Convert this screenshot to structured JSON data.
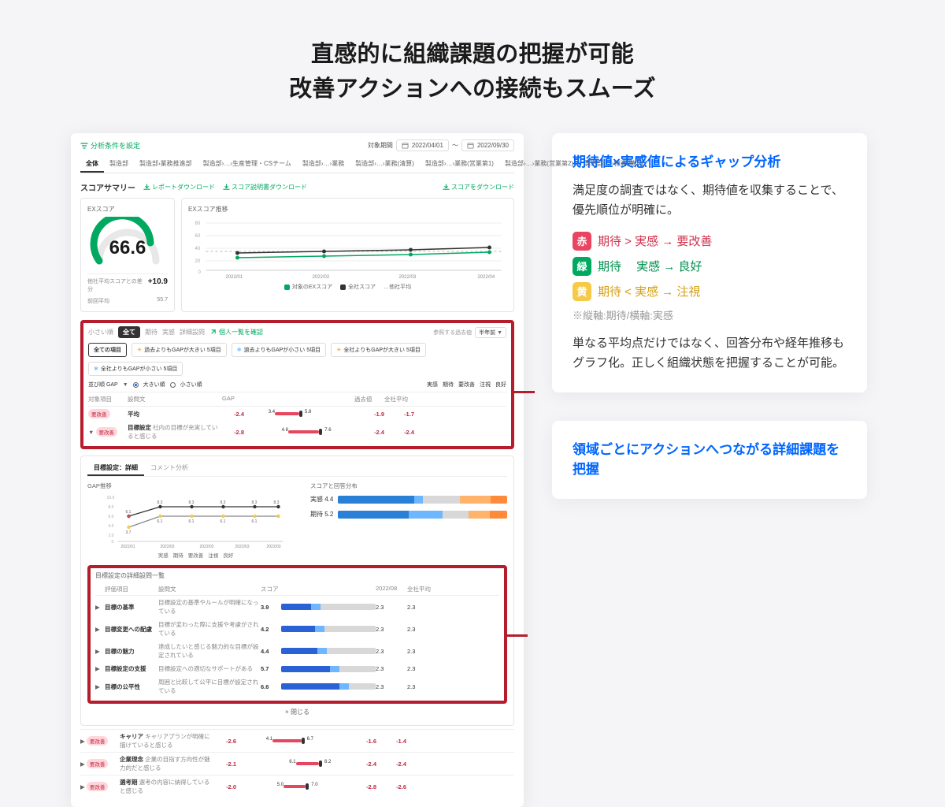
{
  "page_title_1": "直感的に組織課題の把握が可能",
  "page_title_2": "改善アクションへの接続もスムーズ",
  "app": {
    "filter_link": "分析条件を設定",
    "date_label": "対象期間",
    "date_from": "2022/04/01",
    "date_to": "2022/09/30",
    "tabs": [
      "全体",
      "製造部",
      "製造部›業務推進部",
      "製造部›…›生産管理・CSチーム",
      "製造部›…›業務",
      "製造部›…›業務(清算)",
      "製造部›…›業務(営業第1)",
      "製造部›…›業務(営業第2)",
      "製造部›…›物流(横浜)"
    ],
    "summary_title": "スコアサマリー",
    "dl_report": "レポートダウンロード",
    "dl_desc": "スコア説明書ダウンロード",
    "dl_score": "スコアをダウンロード",
    "ex_title": "EXスコア",
    "ex_score": "66.6",
    "diff_label": "他社平均スコアとの差分",
    "diff_value": "+10.9",
    "diff_prev_label": "前回平均",
    "diff_prev": "55.7",
    "trend_title": "EXスコア推移",
    "trend_x": [
      "2022/01",
      "2022/02",
      "2022/03",
      "2022/04"
    ],
    "legend_target": "対象のEXスコア",
    "legend_all": "全社スコア",
    "legend_avg": "…他社平均",
    "filter": {
      "small_order": "小さい順",
      "all": "全て",
      "exp": "期待",
      "real": "実感",
      "detail": "詳細設問",
      "individual": "個人一覧を確認",
      "past_label": "参照する過去値",
      "past_val": "半年前"
    },
    "chips": {
      "all_items": "全ての項目",
      "past_large": "過去よりもGAPが大きい 5項目",
      "past_small": "過去よりもGAPが小さい 5項目",
      "all_large": "全社よりもGAPが大きい 5項目",
      "all_small": "全社よりもGAPが小さい 5項目"
    },
    "sort": {
      "label": "並び順 GAP",
      "large": "大きい順",
      "small": "小さい順",
      "real": "実感",
      "exp": "期待",
      "imp": "要改善",
      "note": "注視",
      "good": "良好"
    },
    "gap_head": {
      "c1": "対象項目",
      "c2": "設問文",
      "c3": "GAP",
      "c4": "過去値",
      "c5": "全社平均"
    },
    "gap_rows": [
      {
        "badge": "要改善",
        "label": "平均",
        "gap": "-2.4",
        "b1": "3.4",
        "b2": "5.8",
        "past": "-1.9",
        "all": "-1.7"
      },
      {
        "badge": "要改善",
        "caret": "▼",
        "label": "目標設定",
        "text": "社内の目標が充実していると感じる",
        "gap": "-2.8",
        "b1": "4.8",
        "b2": "7.6",
        "past": "-2.4",
        "all": "-2.4"
      }
    ],
    "detail": {
      "tab1": "目標設定：詳細",
      "tab2": "コメント分析",
      "gtrend": "GAP推移",
      "gtrend_x": [
        "2022/01",
        "2022/02",
        "2022/02",
        "2022/03",
        "2022/03"
      ],
      "gtrend_vals": [
        "6.1",
        "8.3",
        "8.3",
        "8.3",
        "8.3",
        "8.3"
      ],
      "gtrend_low": "3.7",
      "dist_title": "スコアと回答分布",
      "dist1_label": "実感 4.4",
      "dist2_label": "期待 5.2",
      "legend2": [
        "実感",
        "期待",
        "要改善",
        "注視",
        "良好"
      ]
    },
    "questions": {
      "head": "目標設定の詳細設問一覧",
      "h": {
        "c1": "評価項目",
        "c2": "設問文",
        "c3": "スコア",
        "c4": "2022/08",
        "c5": "全社平均"
      },
      "rows": [
        {
          "name": "目標の基準",
          "q": "目標設定の基準やルールが明確になっている",
          "score": "3.9",
          "past": "2.3",
          "all": "2.3"
        },
        {
          "name": "目標変更への配慮",
          "q": "目標が変わった際に支援や考慮がされている",
          "score": "4.2",
          "past": "2.3",
          "all": "2.3"
        },
        {
          "name": "目標の魅力",
          "q": "達成したいと感じる魅力的な目標が設定されている",
          "score": "4.4",
          "past": "2.3",
          "all": "2.3"
        },
        {
          "name": "目標設定の支援",
          "q": "目標設定への適切なサポートがある",
          "score": "5.7",
          "past": "2.3",
          "all": "2.3"
        },
        {
          "name": "目標の公平性",
          "q": "周囲と比較して公平に目標が設定されている",
          "score": "6.6",
          "past": "2.3",
          "all": "2.3"
        }
      ],
      "close": "閉じる"
    },
    "bottom": [
      {
        "badge": "要改善",
        "name": "キャリア",
        "q": "キャリアプランが明確に描けていると感じる",
        "gap": "-2.6",
        "b1": "4.1",
        "b2": "6.7",
        "past": "-1.6",
        "all": "-1.4"
      },
      {
        "badge": "要改善",
        "name": "企業理念",
        "q": "企業の目指す方向性が魅力的だと感じる",
        "gap": "-2.1",
        "b1": "6.1",
        "b2": "8.2",
        "past": "-2.4",
        "all": "-2.4"
      },
      {
        "badge": "要改善",
        "name": "選考期",
        "q": "選考の内容に納得していると感じる",
        "gap": "-2.0",
        "b1": "5.0",
        "b2": "7.0",
        "past": "-2.8",
        "all": "-2.6"
      }
    ]
  },
  "info1": {
    "title": "期待値×実感値によるギャップ分析",
    "text1": "満足度の調査ではなく、期待値を収集することで、優先順位が明確に。",
    "r": "赤",
    "r_txt": "期待  >  実感 → 要改善",
    "g": "緑",
    "g_txt": "期待　 実感 → 良好",
    "y": "黄",
    "y_txt": "期待 < 実感 → 注視",
    "note": "※縦軸:期待/横軸:実感",
    "text2": "単なる平均点だけではなく、回答分布や経年推移もグラフ化。正しく組織状態を把握することが可能。"
  },
  "info2": {
    "title": "領域ごとにアクションへつながる詳細課題を把握"
  },
  "chart_data": [
    {
      "type": "gauge",
      "title": "EXスコア",
      "value": 66.6,
      "min": 0,
      "max": 100
    },
    {
      "type": "line",
      "title": "EXスコア推移",
      "x": [
        "2022/01",
        "2022/02",
        "2022/03",
        "2022/04"
      ],
      "series": [
        {
          "name": "対象のEXスコア",
          "values": [
            21,
            23,
            25,
            28
          ]
        },
        {
          "name": "全社スコア",
          "values": [
            28,
            30,
            32,
            35
          ]
        },
        {
          "name": "他社平均",
          "values": [
            30,
            30,
            30,
            30
          ]
        }
      ],
      "ylim": [
        0,
        80
      ]
    },
    {
      "type": "line",
      "title": "GAP推移",
      "x": [
        "2022/01",
        "2022/02",
        "2022/02",
        "2022/03",
        "2022/03"
      ],
      "series": [
        {
          "name": "期待",
          "values": [
            6.1,
            8.3,
            8.3,
            8.3,
            8.3
          ]
        },
        {
          "name": "実感",
          "values": [
            3.7,
            6.1,
            6.1,
            6.1,
            6.1
          ]
        }
      ],
      "ylim": [
        0,
        10
      ]
    },
    {
      "type": "stacked_bar",
      "title": "スコアと回答分布",
      "categories": [
        "実感 4.4",
        "期待 5.2"
      ],
      "series": [
        {
          "name": "seg1",
          "values": [
            45,
            42
          ]
        },
        {
          "name": "seg2",
          "values": [
            5,
            20
          ]
        },
        {
          "name": "seg3",
          "values": [
            22,
            15
          ]
        },
        {
          "name": "seg4",
          "values": [
            18,
            13
          ]
        },
        {
          "name": "seg5",
          "values": [
            10,
            10
          ]
        }
      ]
    },
    {
      "type": "bar",
      "title": "目標設定の詳細設問一覧",
      "categories": [
        "目標の基準",
        "目標変更への配慮",
        "目標の魅力",
        "目標設定の支援",
        "目標の公平性"
      ],
      "values": [
        3.9,
        4.2,
        4.4,
        5.7,
        6.6
      ]
    }
  ]
}
